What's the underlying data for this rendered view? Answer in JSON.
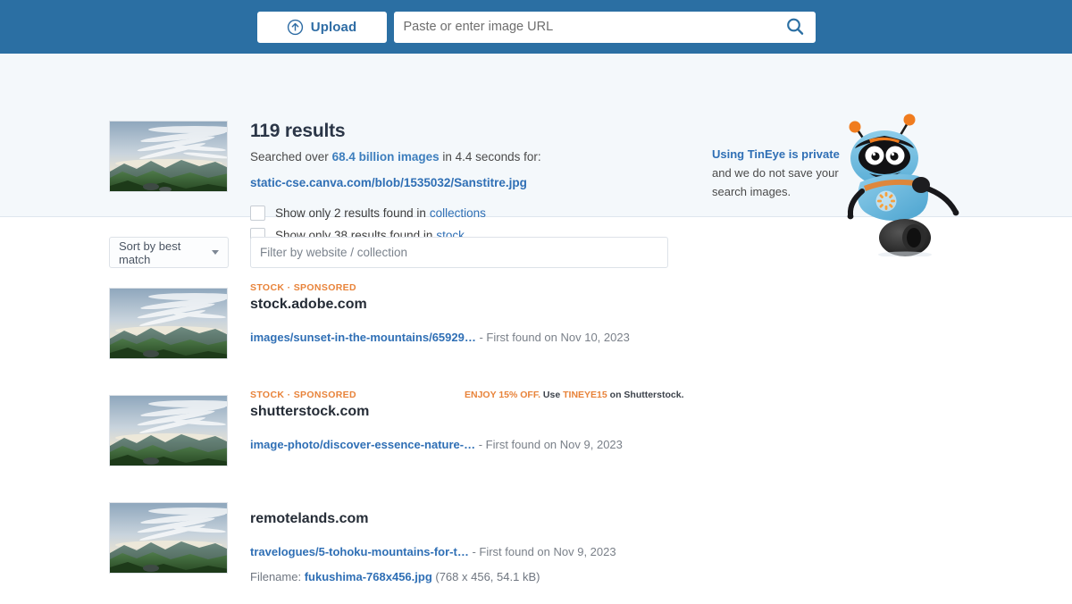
{
  "topbar": {
    "upload_label": "Upload",
    "upload_icon": "upload-circle-arrow-icon",
    "url_placeholder": "Paste or enter image URL",
    "url_value": "",
    "search_icon": "search-magnifier-icon"
  },
  "summary": {
    "results_count": "119 results",
    "searched_prefix": "Searched over ",
    "searched_images": "68.4 billion images",
    "searched_suffix": " in 4.4 seconds for:",
    "query_url": "static-cse.canva.com/blob/1535032/Sanstitre.jpg",
    "thumbnail_alt": "mountain-landscape-thumbnail",
    "checkboxes": [
      {
        "prefix": "Show only 2 results found in",
        "link": "collections",
        "checked": false
      },
      {
        "prefix": "Show only 38 results found in",
        "link": "stock",
        "checked": false
      }
    ],
    "privacy_highlight": "Using TinEye is private",
    "privacy_rest": " and we do not save your search images.",
    "mascot": "tineye-robot-mascot"
  },
  "filters": {
    "sort_label": "Sort by best match",
    "sort_icon": "chevron-down-icon",
    "filter_placeholder": "Filter by website / collection",
    "filter_value": ""
  },
  "results": [
    {
      "tagline": "STOCK · SPONSORED",
      "domain": "stock.adobe.com",
      "path": "images/sunset-in-the-mountains/65929…",
      "date": " - First found on Nov 10, 2023",
      "promo": null,
      "filename": null
    },
    {
      "tagline": "STOCK · SPONSORED",
      "domain": "shutterstock.com",
      "path": "image-photo/discover-essence-nature-…",
      "date": " - First found on Nov 9, 2023",
      "promo": {
        "part1": "ENJOY 15% OFF.",
        "part2": " Use ",
        "part3": "TINEYE15",
        "part4": " on Shutterstock."
      },
      "filename": null
    },
    {
      "tagline": "",
      "domain": "remotelands.com",
      "path": "travelogues/5-tohoku-mountains-for-t…",
      "date": "  - First found on Nov 9, 2023",
      "promo": null,
      "filename": {
        "label": "Filename: ",
        "name": "fukushima-768x456.jpg",
        "meta": " (768 x 456, 54.1 kB)"
      }
    }
  ],
  "colors": {
    "header_blue": "#2b6fa3",
    "panel_bg": "#f4f8fb",
    "link_blue": "#2f6fb5",
    "accent_orange": "#e8833a",
    "text_dark": "#2b3647"
  }
}
